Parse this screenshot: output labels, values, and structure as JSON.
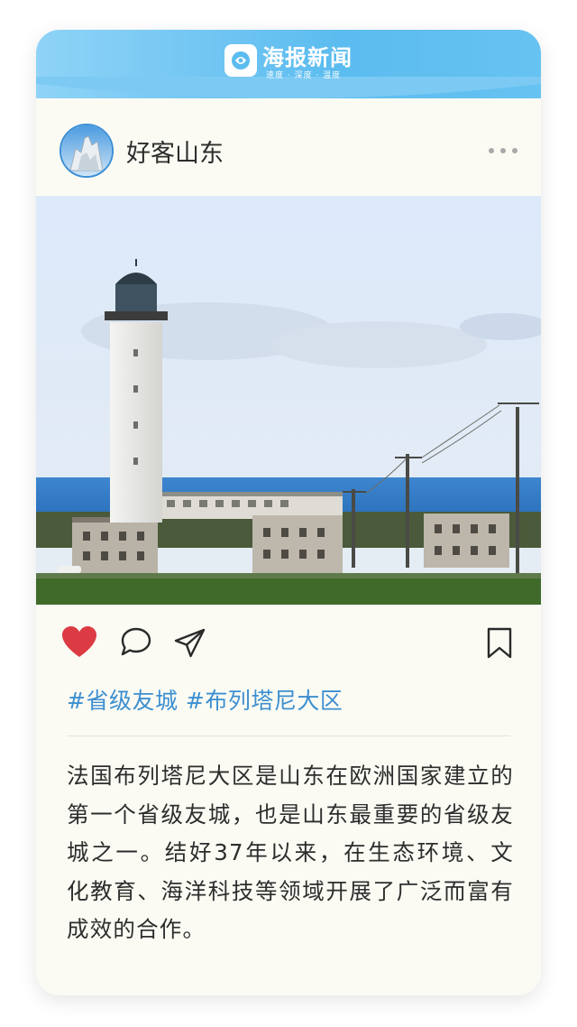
{
  "brand": {
    "name": "海报新闻",
    "slogan": "速度 · 深度 · 温度",
    "colors": {
      "bar_start": "#8fd3f7",
      "bar_end": "#5bbcef"
    }
  },
  "post": {
    "author": "好客山东",
    "avatar_icon": "city-landmark-avatar",
    "more_icon": "more-horizontal-icon",
    "photo": "lighthouse-by-the-sea",
    "actions": {
      "like_icon": "heart-filled-icon",
      "like_color": "#dc3b43",
      "comment_icon": "comment-bubble-icon",
      "share_icon": "paper-plane-icon",
      "bookmark_icon": "bookmark-icon"
    },
    "tags": "#省级友城 #布列塔尼大区",
    "tag_color": "#3d8fd0",
    "text": "法国布列塔尼大区是山东在欧洲国家建立的第一个省级友城，也是山东最重要的省级友城之一。结好37年以来，在生态环境、文化教育、海洋科技等领域开展了广泛而富有成效的合作。"
  }
}
